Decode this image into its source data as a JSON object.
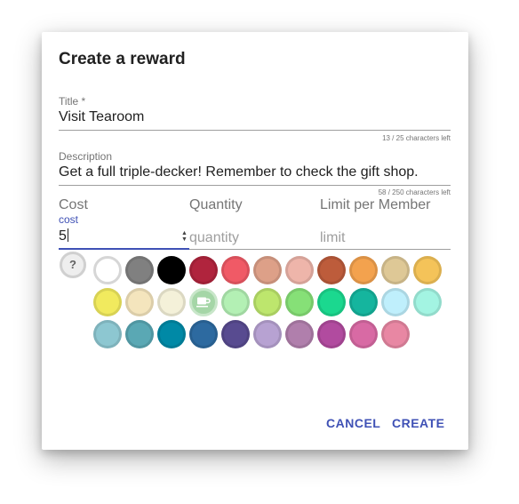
{
  "dialog": {
    "title": "Create a reward",
    "title_field": {
      "label": "Title *",
      "value": "Visit Tearoom",
      "counter": "13 / 25 characters left"
    },
    "description_field": {
      "label": "Description",
      "value": "Get a full triple-decker! Remember to check the gift shop.",
      "counter": "58 / 250 characters left"
    },
    "cost_field": {
      "label": "Cost",
      "sublabel": "cost",
      "value": "5"
    },
    "quantity_field": {
      "label": "Quantity",
      "placeholder": "quantity"
    },
    "limit_field": {
      "label": "Limit per Member",
      "placeholder": "limit"
    },
    "help_button": "?",
    "colors": [
      "#ffffff",
      "#808080",
      "#000000",
      "#b0243d",
      "#f05a66",
      "#dda088",
      "#eeb5aa",
      "#bd5c3b",
      "#f3a24e",
      "#dec896",
      "#f4c359",
      "#f1ea5e",
      "#f4e5bd",
      "#f4f1d9",
      "#a5d6a7",
      "#b3f0b4",
      "#bde66d",
      "#86e077",
      "#1bd88f",
      "#15b59e",
      "#bfeffc",
      "#a3f4e2",
      "#8dc7d1",
      "#5aa8b4",
      "#0089a6",
      "#2d6aa0",
      "#584b90",
      "#b7a2d2",
      "#b07fac",
      "#b14b9f",
      "#d86aa4",
      "#e887a3"
    ],
    "selected_color_index": 14,
    "selected_icon": "tea-cup-icon",
    "actions": {
      "cancel": "CANCEL",
      "create": "CREATE"
    },
    "accent_color": "#3f51b5"
  }
}
